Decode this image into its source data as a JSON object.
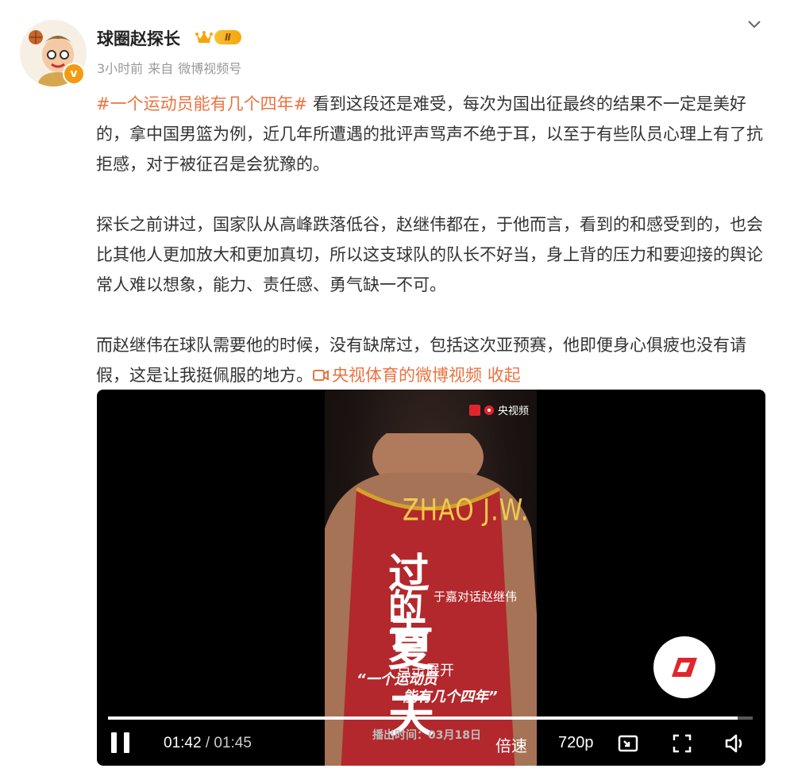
{
  "author": {
    "name": "球圈赵探长",
    "level_badge": "Ⅱ",
    "verified_mark": "v",
    "time": "3小时前",
    "source_prefix": "来自",
    "source": "微博视频号"
  },
  "post": {
    "topic": "#一个运动员能有几个四年#",
    "para1": "看到这段还是难受，每次为国出征最终的结果不一定是美好的，拿中国男篮为例，近几年所遭遇的批评声骂声不绝于耳，以至于有些队员心理上有了抗拒感，对于被征召是会犹豫的。",
    "para2": "探长之前讲过，国家队从高峰跌落低谷，赵继伟都在，于他而言，看到的和感受到的，也会比其他人更加放大和更加真切，所以这支球队的队长不好当，身上背的压力和要迎接的舆论常人难以想象，能力、责任感、勇气缺一不可。",
    "para3": "而赵继伟在球队需要他的时候，没有缺席过，包括这次亚预赛，他即便身心俱疲也没有请假，这是让我挺佩服的地方。",
    "video_link": "央视体育的微博视频",
    "collapse": "收起"
  },
  "video": {
    "watermark": "央视频",
    "jersey_name": "ZHAO J.W.",
    "title_chars": [
      "过去",
      "的",
      "夏天"
    ],
    "subtitle": "于嘉对话赵继伟",
    "quote_line1": "“一个运动员",
    "quote_line2": "能有几个四年”",
    "air_time": "播出时间：03月18日",
    "expand_label": "点击展开",
    "progress_fraction": 0.977,
    "current_time": "01:42",
    "separator": " / ",
    "duration": "01:45",
    "speed_label": "倍速",
    "quality_label": "720p"
  },
  "colors": {
    "accent": "#eb7340",
    "brand_red": "#e0262c"
  }
}
